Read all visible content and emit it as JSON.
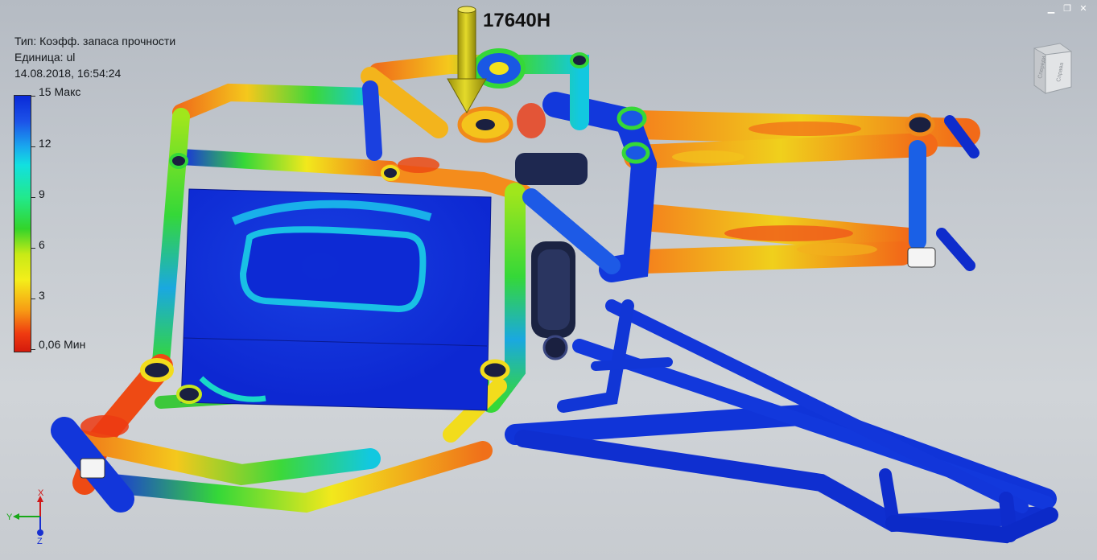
{
  "info": {
    "type_line": "Тип: Коэфф. запаса прочности",
    "unit_line": "Единица: ul",
    "date_line": "14.08.2018, 16:54:24"
  },
  "legend": {
    "labels": [
      "15 Макс",
      "12",
      "9",
      "6",
      "3",
      "0,06 Мин"
    ],
    "max_value": 15,
    "min_value": 0.06,
    "colors": [
      "#0a2ad8",
      "#19a8ee",
      "#12e0e0",
      "#33d42a",
      "#f4ee1a",
      "#f79a14",
      "#d41a0c"
    ]
  },
  "force": {
    "label": "17640H",
    "arrow_color": "#c8be1c"
  },
  "viewcube": {
    "face_front": "Спереди",
    "face_right": "Справа"
  },
  "triad": {
    "x": "X",
    "y": "Y",
    "z": "Z"
  },
  "window": {
    "minimize": "▁",
    "restore": "❐",
    "close": "✕"
  },
  "icons": {
    "legend": "color-scale-icon",
    "force": "force-arrow-icon",
    "viewcube": "view-cube-icon",
    "triad": "axis-triad-icon"
  }
}
